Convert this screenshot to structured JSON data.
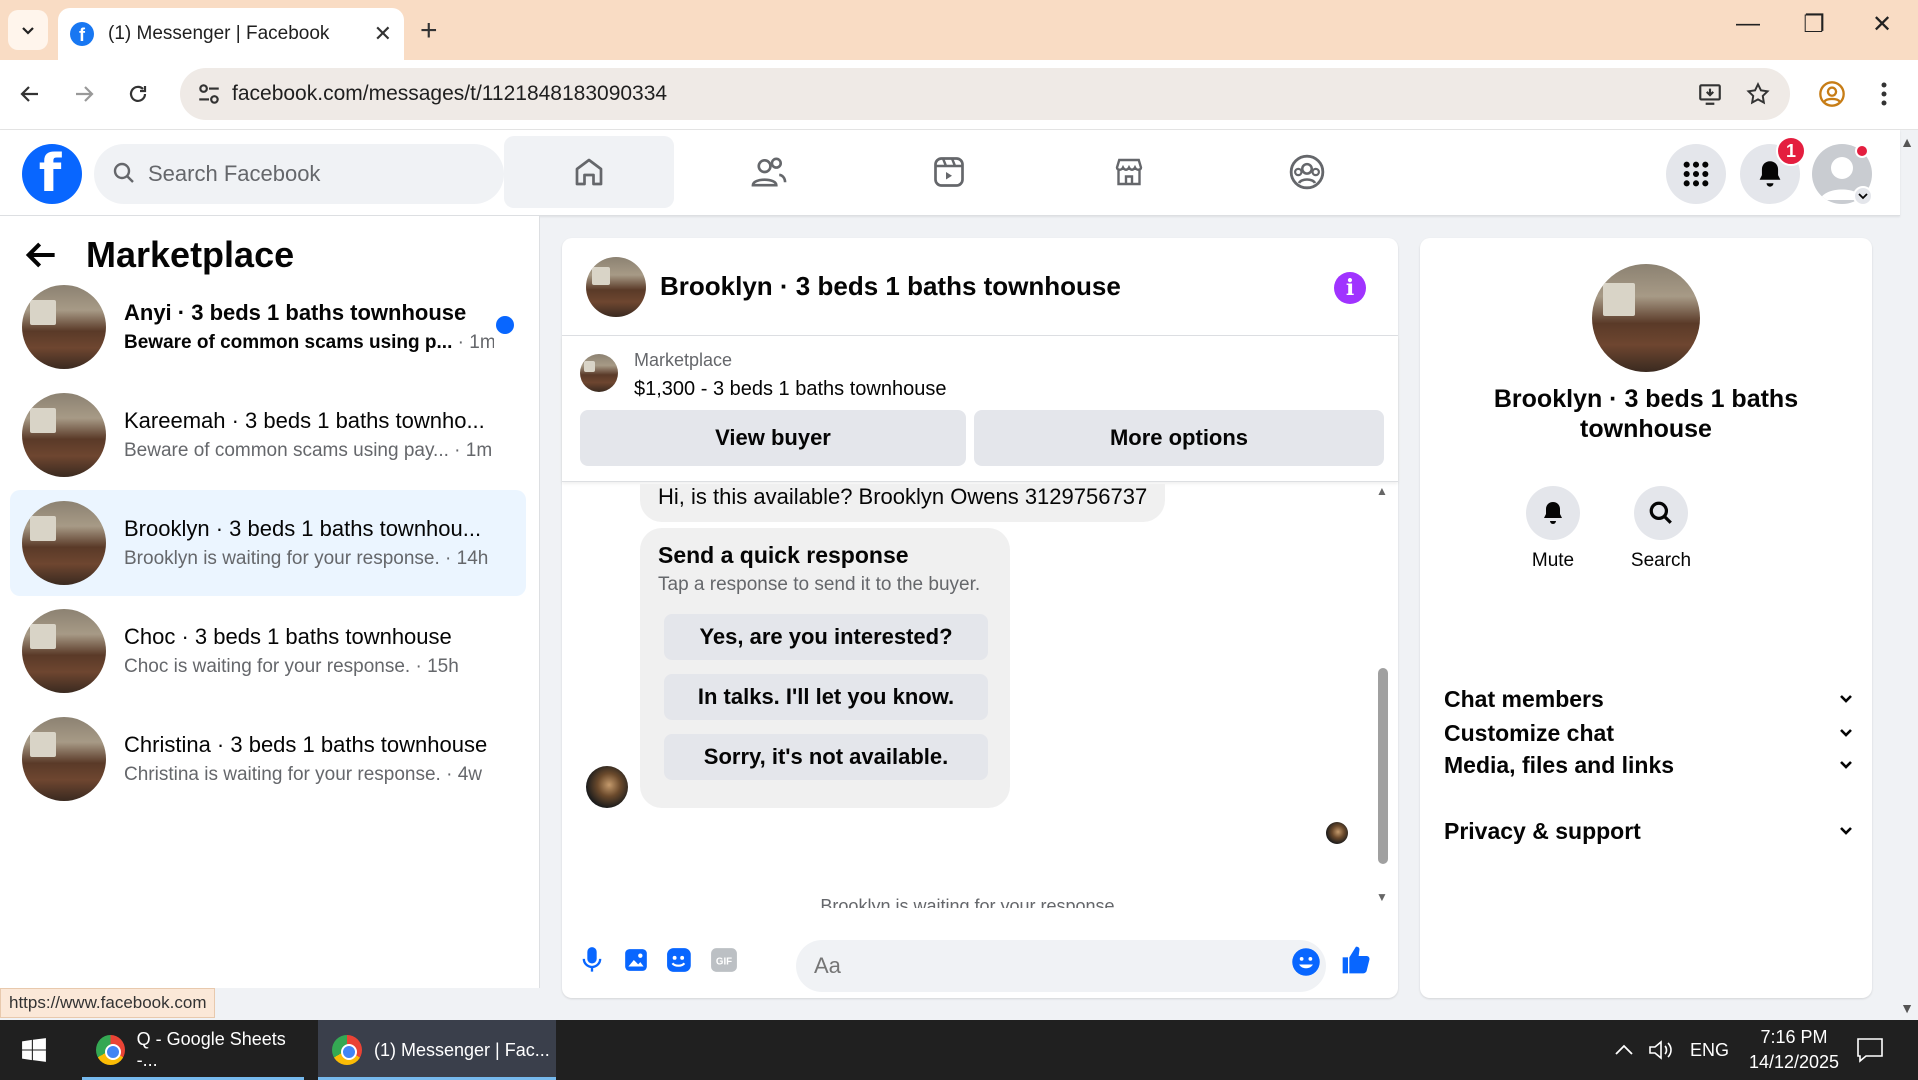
{
  "browser": {
    "tab_title": "(1) Messenger | Facebook",
    "url": "facebook.com/messages/t/1121848183090334",
    "status_url": "https://www.facebook.com"
  },
  "fb_header": {
    "search_placeholder": "Search Facebook",
    "notification_count": "1"
  },
  "sidebar": {
    "back_icon": "arrow-left-icon",
    "title": "Marketplace",
    "conversations": [
      {
        "name": "Anyi · 3 beds 1 baths townhouse",
        "preview": "Beware of common scams using p...",
        "time": "1m",
        "unread": true
      },
      {
        "name": "Kareemah · 3 beds 1 baths townho...",
        "preview": "Beware of common scams using pay...",
        "time": "1m",
        "unread": false
      },
      {
        "name": "Brooklyn · 3 beds 1 baths townhou...",
        "preview": "Brooklyn is waiting for your response.",
        "time": "14h",
        "unread": false,
        "active": true
      },
      {
        "name": "Choc · 3 beds 1 baths townhouse",
        "preview": "Choc is waiting for your response.",
        "time": "15h",
        "unread": false
      },
      {
        "name": "Christina · 3 beds 1 baths townhouse",
        "preview": "Christina is waiting for your response.",
        "time": "4w",
        "unread": false
      }
    ]
  },
  "chat": {
    "title": "Brooklyn · 3 beds 1 baths townhouse",
    "listing_label": "Marketplace",
    "listing_price": "$1,300 - 3 beds 1 baths townhouse",
    "view_buyer": "View buyer",
    "more_options": "More options",
    "first_message": "Hi, is this available? Brooklyn Owens 3129756737",
    "quick_title": "Send a quick response",
    "quick_subtitle": "Tap a response to send it to the buyer.",
    "quick_responses": [
      "Yes, are you interested?",
      "In talks. I'll let you know.",
      "Sorry, it's not available."
    ],
    "waiting_text": "Brooklyn is waiting for your response.",
    "composer_placeholder": "Aa"
  },
  "details": {
    "title": "Brooklyn · 3 beds 1 baths townhouse",
    "mute": "Mute",
    "search": "Search",
    "sections": [
      "Customize chat",
      "Chat members",
      "Media, files and links",
      "Privacy & support"
    ]
  },
  "taskbar": {
    "item1": "Q - Google Sheets -...",
    "item2": "(1) Messenger | Fac...",
    "lang": "ENG",
    "time": "7:16 PM",
    "date": "14/12/2025"
  },
  "colors": {
    "fb_blue": "#0866ff",
    "unread_blue": "#0866ff",
    "notification_red": "#e41e3f",
    "info_purple": "#a033ff",
    "active_row": "#ebf5ff"
  }
}
